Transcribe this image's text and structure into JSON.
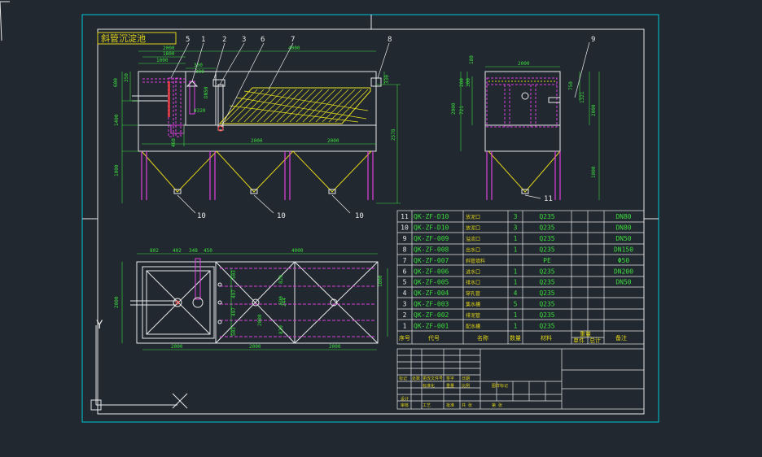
{
  "drawing": {
    "title_tag": "斜管沉淀池",
    "colors": {
      "background": "#212830",
      "frame": "#00c8d8",
      "outline": "#e8e8e8",
      "dimension": "#3ddc3d",
      "hopper": "#e0d21a",
      "pipe": "#e040e0",
      "tube_settler": "#e8e020",
      "pipe_flange": "#ff4040"
    },
    "callouts_front": [
      "5",
      "1",
      "2",
      "3",
      "6",
      "7",
      "8",
      "10",
      "10",
      "10"
    ],
    "callouts_side": [
      "9",
      "11"
    ],
    "front_dims": {
      "top": [
        "2000",
        "1800",
        "1000",
        "300",
        "300",
        "4000"
      ],
      "left": [
        "600",
        "350",
        "1400",
        "1000"
      ],
      "right": [
        "330",
        "2578"
      ],
      "bottom": [
        "2000",
        "2000"
      ],
      "small": [
        "460",
        "Φ320",
        "DN50"
      ]
    },
    "side_dims": {
      "top": "2000",
      "left": [
        "180",
        "200",
        "300",
        "2000",
        "721"
      ],
      "right": [
        "750",
        "1321",
        "2000",
        "1000"
      ]
    },
    "plan_dims": {
      "top": [
        "802",
        "402",
        "348",
        "450",
        "4000"
      ],
      "left": "2000",
      "right": "1800",
      "inner": [
        "503",
        "497",
        "497",
        "503",
        "820",
        "690",
        "244",
        "2080",
        "820"
      ],
      "bottom": [
        "2000",
        "2000",
        "2000"
      ]
    },
    "bom": {
      "rows": [
        {
          "no": "11",
          "code": "QK-ZF-D10",
          "name": "放泥口",
          "qty": "3",
          "material": "Q235",
          "remark": "DN80"
        },
        {
          "no": "10",
          "code": "QK-ZF-D10",
          "name": "放泥口",
          "qty": "3",
          "material": "Q235",
          "remark": "DN80"
        },
        {
          "no": "9",
          "code": "QK-ZF-009",
          "name": "溢流口",
          "qty": "1",
          "material": "Q235",
          "remark": "DN50"
        },
        {
          "no": "8",
          "code": "QK-ZF-008",
          "name": "出水口",
          "qty": "1",
          "material": "Q235",
          "remark": "DN150"
        },
        {
          "no": "7",
          "code": "QK-ZF-007",
          "name": "斜管填料",
          "qty": "",
          "material": "PE",
          "remark": "Φ50"
        },
        {
          "no": "6",
          "code": "QK-ZF-006",
          "name": "进水口",
          "qty": "1",
          "material": "Q235",
          "remark": "DN200"
        },
        {
          "no": "5",
          "code": "QK-ZF-005",
          "name": "排水口",
          "qty": "1",
          "material": "Q235",
          "remark": "DN50"
        },
        {
          "no": "4",
          "code": "QK-ZF-004",
          "name": "穿孔管",
          "qty": "4",
          "material": "Q235",
          "remark": ""
        },
        {
          "no": "3",
          "code": "QK-ZF-003",
          "name": "集水槽",
          "qty": "5",
          "material": "Q235",
          "remark": ""
        },
        {
          "no": "2",
          "code": "QK-ZF-002",
          "name": "排泥管",
          "qty": "1",
          "material": "Q235",
          "remark": ""
        },
        {
          "no": "1",
          "code": "QK-ZF-001",
          "name": "配水槽",
          "qty": "1",
          "material": "Q235",
          "remark": ""
        }
      ],
      "header": [
        "序号",
        "代号",
        "名称",
        "数量",
        "材料",
        "单件",
        "总计",
        "备注"
      ],
      "header_sub": [
        "重量"
      ]
    },
    "title_block": {
      "labels": [
        "标记",
        "处数",
        "更改文件号",
        "签字",
        "日期",
        "设计",
        "标准化",
        "审核",
        "工艺",
        "批准",
        "图样标记",
        "重量",
        "比例",
        "共 张",
        "第 张"
      ]
    },
    "ucs": {
      "axis_y": "Y",
      "axis_x": "X"
    }
  }
}
